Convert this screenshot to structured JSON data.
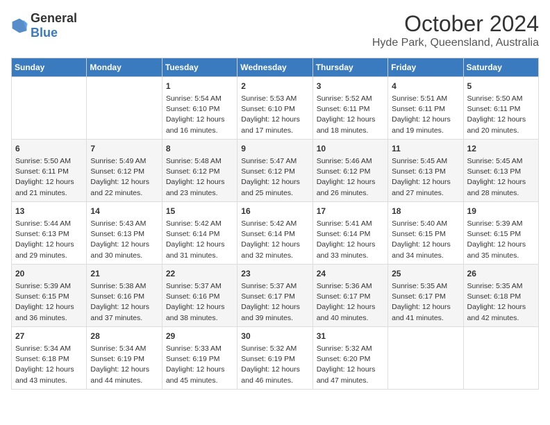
{
  "header": {
    "logo": {
      "general": "General",
      "blue": "Blue"
    },
    "title": "October 2024",
    "location": "Hyde Park, Queensland, Australia"
  },
  "weekdays": [
    "Sunday",
    "Monday",
    "Tuesday",
    "Wednesday",
    "Thursday",
    "Friday",
    "Saturday"
  ],
  "weeks": [
    [
      {
        "day": null
      },
      {
        "day": null
      },
      {
        "day": "1",
        "sunrise": "5:54 AM",
        "sunset": "6:10 PM",
        "daylight": "12 hours and 16 minutes."
      },
      {
        "day": "2",
        "sunrise": "5:53 AM",
        "sunset": "6:10 PM",
        "daylight": "12 hours and 17 minutes."
      },
      {
        "day": "3",
        "sunrise": "5:52 AM",
        "sunset": "6:11 PM",
        "daylight": "12 hours and 18 minutes."
      },
      {
        "day": "4",
        "sunrise": "5:51 AM",
        "sunset": "6:11 PM",
        "daylight": "12 hours and 19 minutes."
      },
      {
        "day": "5",
        "sunrise": "5:50 AM",
        "sunset": "6:11 PM",
        "daylight": "12 hours and 20 minutes."
      }
    ],
    [
      {
        "day": "6",
        "sunrise": "5:50 AM",
        "sunset": "6:11 PM",
        "daylight": "12 hours and 21 minutes."
      },
      {
        "day": "7",
        "sunrise": "5:49 AM",
        "sunset": "6:12 PM",
        "daylight": "12 hours and 22 minutes."
      },
      {
        "day": "8",
        "sunrise": "5:48 AM",
        "sunset": "6:12 PM",
        "daylight": "12 hours and 23 minutes."
      },
      {
        "day": "9",
        "sunrise": "5:47 AM",
        "sunset": "6:12 PM",
        "daylight": "12 hours and 25 minutes."
      },
      {
        "day": "10",
        "sunrise": "5:46 AM",
        "sunset": "6:12 PM",
        "daylight": "12 hours and 26 minutes."
      },
      {
        "day": "11",
        "sunrise": "5:45 AM",
        "sunset": "6:13 PM",
        "daylight": "12 hours and 27 minutes."
      },
      {
        "day": "12",
        "sunrise": "5:45 AM",
        "sunset": "6:13 PM",
        "daylight": "12 hours and 28 minutes."
      }
    ],
    [
      {
        "day": "13",
        "sunrise": "5:44 AM",
        "sunset": "6:13 PM",
        "daylight": "12 hours and 29 minutes."
      },
      {
        "day": "14",
        "sunrise": "5:43 AM",
        "sunset": "6:13 PM",
        "daylight": "12 hours and 30 minutes."
      },
      {
        "day": "15",
        "sunrise": "5:42 AM",
        "sunset": "6:14 PM",
        "daylight": "12 hours and 31 minutes."
      },
      {
        "day": "16",
        "sunrise": "5:42 AM",
        "sunset": "6:14 PM",
        "daylight": "12 hours and 32 minutes."
      },
      {
        "day": "17",
        "sunrise": "5:41 AM",
        "sunset": "6:14 PM",
        "daylight": "12 hours and 33 minutes."
      },
      {
        "day": "18",
        "sunrise": "5:40 AM",
        "sunset": "6:15 PM",
        "daylight": "12 hours and 34 minutes."
      },
      {
        "day": "19",
        "sunrise": "5:39 AM",
        "sunset": "6:15 PM",
        "daylight": "12 hours and 35 minutes."
      }
    ],
    [
      {
        "day": "20",
        "sunrise": "5:39 AM",
        "sunset": "6:15 PM",
        "daylight": "12 hours and 36 minutes."
      },
      {
        "day": "21",
        "sunrise": "5:38 AM",
        "sunset": "6:16 PM",
        "daylight": "12 hours and 37 minutes."
      },
      {
        "day": "22",
        "sunrise": "5:37 AM",
        "sunset": "6:16 PM",
        "daylight": "12 hours and 38 minutes."
      },
      {
        "day": "23",
        "sunrise": "5:37 AM",
        "sunset": "6:17 PM",
        "daylight": "12 hours and 39 minutes."
      },
      {
        "day": "24",
        "sunrise": "5:36 AM",
        "sunset": "6:17 PM",
        "daylight": "12 hours and 40 minutes."
      },
      {
        "day": "25",
        "sunrise": "5:35 AM",
        "sunset": "6:17 PM",
        "daylight": "12 hours and 41 minutes."
      },
      {
        "day": "26",
        "sunrise": "5:35 AM",
        "sunset": "6:18 PM",
        "daylight": "12 hours and 42 minutes."
      }
    ],
    [
      {
        "day": "27",
        "sunrise": "5:34 AM",
        "sunset": "6:18 PM",
        "daylight": "12 hours and 43 minutes."
      },
      {
        "day": "28",
        "sunrise": "5:34 AM",
        "sunset": "6:19 PM",
        "daylight": "12 hours and 44 minutes."
      },
      {
        "day": "29",
        "sunrise": "5:33 AM",
        "sunset": "6:19 PM",
        "daylight": "12 hours and 45 minutes."
      },
      {
        "day": "30",
        "sunrise": "5:32 AM",
        "sunset": "6:19 PM",
        "daylight": "12 hours and 46 minutes."
      },
      {
        "day": "31",
        "sunrise": "5:32 AM",
        "sunset": "6:20 PM",
        "daylight": "12 hours and 47 minutes."
      },
      {
        "day": null
      },
      {
        "day": null
      }
    ]
  ],
  "labels": {
    "sunrise_prefix": "Sunrise: ",
    "sunset_prefix": "Sunset: ",
    "daylight_prefix": "Daylight: "
  }
}
